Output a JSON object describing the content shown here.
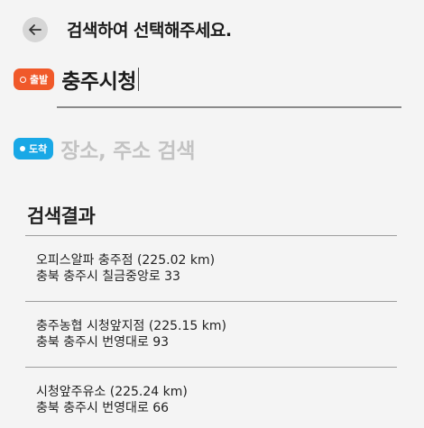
{
  "header": {
    "title": "검색하여 선택해주세요."
  },
  "origin": {
    "badge_label": "출발",
    "badge_color": "#f0592a",
    "value": "충주시청"
  },
  "destination": {
    "badge_label": "도착",
    "badge_color": "#19a8e6",
    "placeholder": "장소, 주소 검색"
  },
  "results": {
    "title": "검색결과",
    "items": [
      {
        "name": "오피스알파 충주점 (225.02 km)",
        "address": "충북 충주시 칠금중앙로 33"
      },
      {
        "name": "충주농협 시청앞지점 (225.15 km)",
        "address": "충북 충주시 번영대로 93"
      },
      {
        "name": "시청앞주유소 (225.24 km)",
        "address": "충북 충주시 번영대로 66"
      }
    ]
  }
}
